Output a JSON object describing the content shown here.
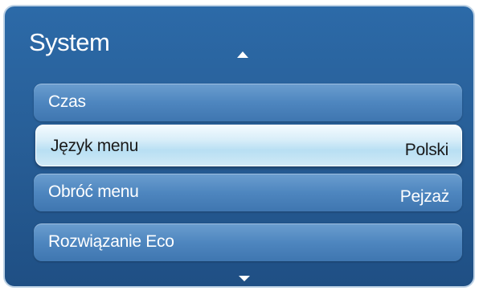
{
  "menu": {
    "title": "System",
    "items": [
      {
        "label": "Czas",
        "value": ""
      },
      {
        "label": "Język menu",
        "value": "Polski",
        "selected": true
      },
      {
        "label": "Obróć menu",
        "value": "Pejzaż"
      },
      {
        "label": "Rozwiązanie Eco",
        "value": ""
      }
    ]
  },
  "colors": {
    "panel": "#285f98",
    "item": "#4e86bf",
    "selected": "#cfe9f6"
  },
  "icons": {
    "scroll_up": "triangle-up-icon",
    "scroll_down": "triangle-down-icon"
  }
}
